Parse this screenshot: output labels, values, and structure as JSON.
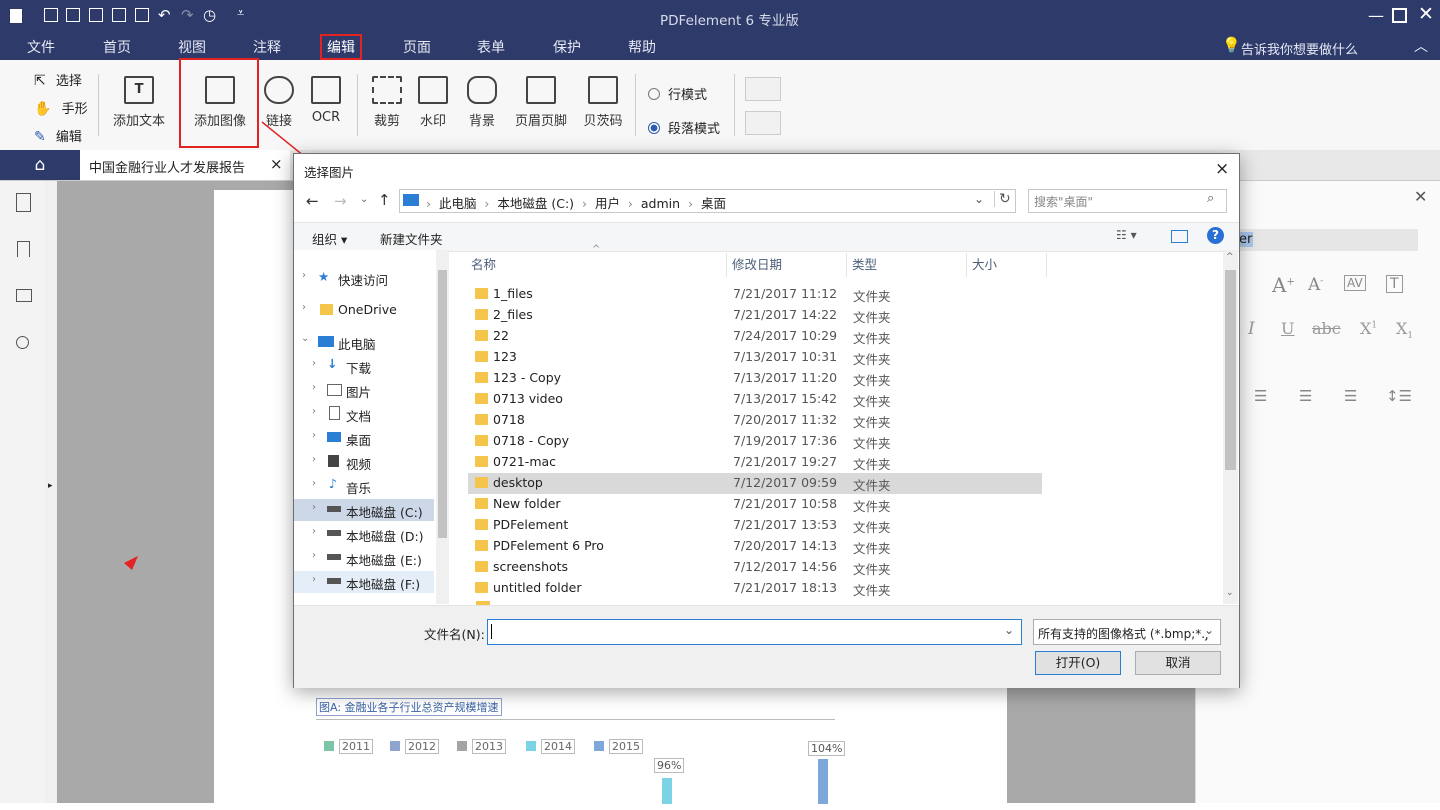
{
  "app": {
    "title": "PDFelement  6 专业版",
    "menu": [
      "文件",
      "首页",
      "视图",
      "注释",
      "编辑",
      "页面",
      "表单",
      "保护",
      "帮助"
    ],
    "active_menu": "编辑",
    "tell_me": "告诉我你想要做什么"
  },
  "ribbon": {
    "select": "选择",
    "hand": "手形",
    "edit": "编辑",
    "add_text": "添加文本",
    "add_image": "添加图像",
    "link": "链接",
    "ocr": "OCR",
    "crop": "裁剪",
    "watermark": "水印",
    "background": "背景",
    "header_footer": "页眉页脚",
    "bates": "贝茨码",
    "line_mode": "行模式",
    "paragraph_mode": "段落模式"
  },
  "tab": {
    "doc_title": "中国金融行业人才发展报告",
    "close": "×"
  },
  "right_panel": {
    "font_field": "er"
  },
  "dialog": {
    "title": "选择图片",
    "close": "×",
    "breadcrumb": [
      "此电脑",
      "本地磁盘 (C:)",
      "用户",
      "admin",
      "桌面"
    ],
    "search_placeholder": "搜索\"桌面\"",
    "organize": "组织 ▾",
    "new_folder": "新建文件夹",
    "tree": [
      {
        "label": "快速访问",
        "icon": "star-icon"
      },
      {
        "label": "OneDrive",
        "icon": "folder-icon"
      },
      {
        "label": "此电脑",
        "icon": "computer-icon"
      },
      {
        "label": "下载",
        "icon": "download-icon"
      },
      {
        "label": "图片",
        "icon": "pictures-icon"
      },
      {
        "label": "文档",
        "icon": "document-icon"
      },
      {
        "label": "桌面",
        "icon": "desktop-icon"
      },
      {
        "label": "视频",
        "icon": "video-icon"
      },
      {
        "label": "音乐",
        "icon": "music-icon"
      },
      {
        "label": "本地磁盘 (C:)",
        "icon": "drive-icon"
      },
      {
        "label": "本地磁盘 (D:)",
        "icon": "drive-icon"
      },
      {
        "label": "本地磁盘 (E:)",
        "icon": "drive-icon"
      },
      {
        "label": "本地磁盘 (F:)",
        "icon": "drive-icon"
      }
    ],
    "columns": [
      "名称",
      "修改日期",
      "类型",
      "大小"
    ],
    "files": [
      {
        "name": "1_files",
        "date": "7/21/2017 11:12",
        "type": "文件夹"
      },
      {
        "name": "2_files",
        "date": "7/21/2017 14:22",
        "type": "文件夹"
      },
      {
        "name": "22",
        "date": "7/24/2017 10:29",
        "type": "文件夹"
      },
      {
        "name": "123",
        "date": "7/13/2017 10:31",
        "type": "文件夹"
      },
      {
        "name": "123 - Copy",
        "date": "7/13/2017 11:20",
        "type": "文件夹"
      },
      {
        "name": "0713 video",
        "date": "7/13/2017 15:42",
        "type": "文件夹"
      },
      {
        "name": "0718",
        "date": "7/20/2017 11:32",
        "type": "文件夹"
      },
      {
        "name": "0718 - Copy",
        "date": "7/19/2017 17:36",
        "type": "文件夹"
      },
      {
        "name": "0721-mac",
        "date": "7/21/2017 19:27",
        "type": "文件夹"
      },
      {
        "name": "desktop",
        "date": "7/12/2017 09:59",
        "type": "文件夹"
      },
      {
        "name": "New folder",
        "date": "7/21/2017 10:58",
        "type": "文件夹"
      },
      {
        "name": "PDFelement",
        "date": "7/21/2017 13:53",
        "type": "文件夹"
      },
      {
        "name": "PDFelement 6 Pro",
        "date": "7/20/2017 14:13",
        "type": "文件夹"
      },
      {
        "name": "screenshots",
        "date": "7/12/2017 14:56",
        "type": "文件夹"
      },
      {
        "name": "untitled folder",
        "date": "7/21/2017 18:13",
        "type": "文件夹"
      }
    ],
    "selected_file": "desktop",
    "filename_label": "文件名(N):",
    "filename_value": "",
    "filter": "所有支持的图像格式 (*.bmp;*.j",
    "open": "打开(O)",
    "cancel": "取消"
  },
  "page_content": {
    "figure_caption": "图A: 金融业各子行业总资产规模增速",
    "legend": [
      "2011",
      "2012",
      "2013",
      "2014",
      "2015"
    ],
    "legend_colors": [
      "#7cc4a6",
      "#8fa3cf",
      "#a4a4a4",
      "#7dd3e6",
      "#7ea8d9"
    ],
    "labels": [
      "96%",
      "104%"
    ]
  },
  "colors": {
    "titlebar": "#2d3a6a",
    "highlight": "#e32222"
  }
}
